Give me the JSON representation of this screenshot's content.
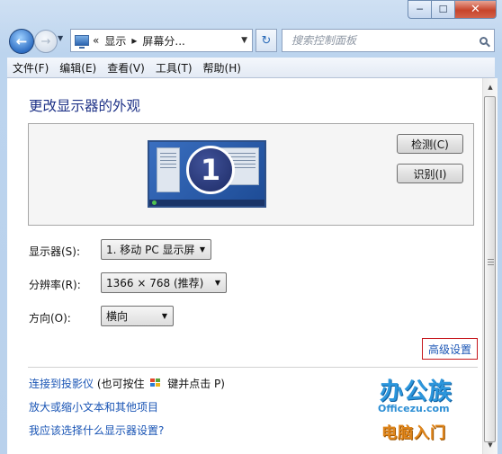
{
  "window": {
    "caption_buttons": {
      "minimize": "─",
      "maximize": "☐",
      "close": "✕"
    }
  },
  "nav": {
    "back_glyph": "←",
    "forward_glyph": "→",
    "address": {
      "prefix": "«",
      "seg1": "显示",
      "sep": "▸",
      "seg2": "屏幕分...",
      "caret": "▼"
    },
    "refresh_glyph": "↻",
    "search_placeholder": "搜索控制面板"
  },
  "menu": [
    "文件(F)",
    "编辑(E)",
    "查看(V)",
    "工具(T)",
    "帮助(H)"
  ],
  "main": {
    "heading": "更改显示器的外观",
    "monitor_number": "1",
    "detect_button": "检测(C)",
    "identify_button": "识别(I)",
    "display_label": "显示器(S):",
    "display_value": "1. 移动 PC 显示屏",
    "resolution_label": "分辨率(R):",
    "resolution_value": "1366 × 768 (推荐)",
    "orientation_label": "方向(O):",
    "orientation_value": "横向",
    "advanced_link": "高级设置",
    "links": {
      "projector_link": "连接到投影仪",
      "projector_hint_pre": "(也可按住",
      "projector_hint_post": "键并点击 P)",
      "text_size_link": "放大或缩小文本和其他项目",
      "which_settings_link": "我应该选择什么显示器设置?"
    }
  },
  "watermark": {
    "title": "办公族",
    "url": "Officezu.com",
    "subtitle": "电脑入门"
  },
  "scrollbar": {
    "up": "▲",
    "down": "▼"
  },
  "colors": {
    "link": "#1a55b5",
    "heading": "#1e3287",
    "highlight_border": "#c6161c"
  }
}
